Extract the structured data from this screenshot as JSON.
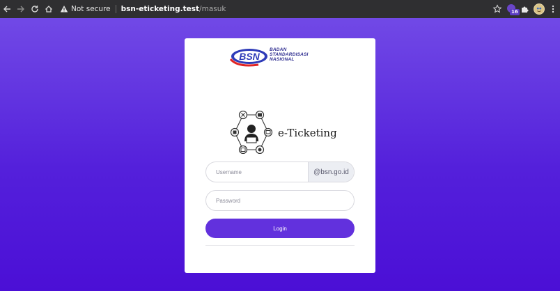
{
  "browser": {
    "security_label": "Not secure",
    "url_host": "bsn-eticketing.test",
    "url_path": "/masuk",
    "extension_badge": "16",
    "icons": [
      "back-icon",
      "forward-icon",
      "reload-icon",
      "home-icon",
      "warning-icon",
      "star-icon",
      "extension-icon",
      "puzzle-icon",
      "profile-avatar",
      "menu-icon"
    ]
  },
  "logo": {
    "abbr": "BSN",
    "line1": "BADAN",
    "line2": "STANDARDISASI",
    "line3": "NASIONAL"
  },
  "app": {
    "name": "e-Ticketing"
  },
  "form": {
    "username_placeholder": "Username",
    "email_suffix": "@bsn.go.id",
    "password_placeholder": "Password",
    "login_label": "Login"
  },
  "colors": {
    "accent": "#6231dd",
    "background_top": "#7149e6",
    "background_bottom": "#4b0fd6",
    "brand_blue": "#2d2c8f",
    "brand_red": "#e02424"
  }
}
